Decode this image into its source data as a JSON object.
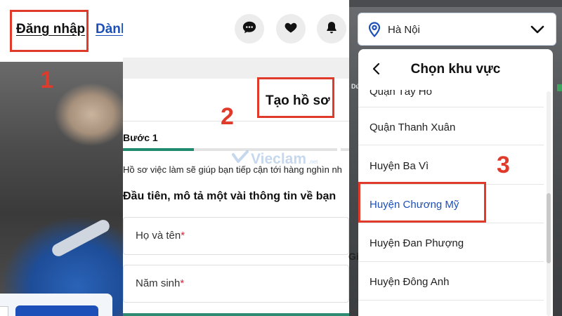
{
  "panel1": {
    "login_label": "Đăng nhập",
    "register_label": "Dành"
  },
  "panel2": {
    "icons": [
      "chat-icon",
      "heart-icon",
      "bell-icon"
    ],
    "page_title": "Tạo hồ sơ",
    "step_label": "Bước 1",
    "progress": 0.33,
    "watermark": "Vieclam",
    "watermark_suffix": ".net",
    "description": "Hồ sơ việc làm sẽ giúp bạn tiếp cận tới hàng nghìn nh",
    "section_heading": "Đầu tiên, mô tả một vài thông tin về bạn",
    "fields": [
      {
        "label": "Họ và tên",
        "required": "*"
      },
      {
        "label": "Năm sinh",
        "required": "*"
      }
    ]
  },
  "panel3": {
    "location_select": {
      "value": "Hà Nội"
    },
    "modal_title": "Chọn khu vực",
    "partial_item": "Quận Tây Hồ",
    "items": [
      {
        "label": "Quận Thanh Xuân",
        "selected": false
      },
      {
        "label": "Huyện Ba Vì",
        "selected": false
      },
      {
        "label": "Huyện Chương Mỹ",
        "selected": true
      },
      {
        "label": "Huyện Đan Phượng",
        "selected": false
      },
      {
        "label": "Huyện Đông Anh",
        "selected": false
      }
    ],
    "peek_text": "Gi",
    "side_text": "Dứ"
  },
  "annotations": {
    "step1": "1",
    "step2": "2",
    "step3": "3"
  },
  "colors": {
    "accent_red": "#e03a2b",
    "brand_blue": "#1c4fb8",
    "progress_green": "#1f8a6e"
  }
}
